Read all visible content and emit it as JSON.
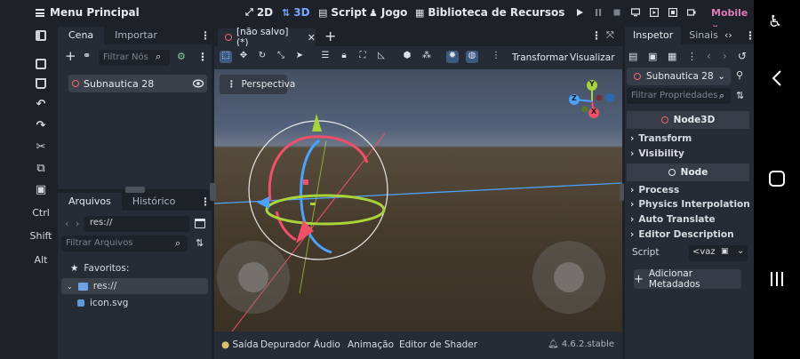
{
  "topbar": {
    "menu_label": "Menu Principal",
    "modes": [
      {
        "label": "2D",
        "icon": "2d-icon"
      },
      {
        "label": "3D",
        "icon": "3d-icon"
      },
      {
        "label": "Script",
        "icon": "script-icon"
      },
      {
        "label": "Jogo",
        "icon": "game-icon"
      },
      {
        "label": "Biblioteca de Recursos",
        "icon": "asset-library-icon"
      }
    ],
    "active_mode": "3D",
    "mobile_label": "Mobile"
  },
  "lefttools": {
    "ctrl_label": "Ctrl",
    "shift_label": "Shift",
    "alt_label": "Alt"
  },
  "scene_dock": {
    "tabs": [
      "Cena",
      "Importar"
    ],
    "filter_placeholder": "Filtrar Nós",
    "root_node": "Subnautica 28"
  },
  "fs_dock": {
    "tabs": [
      "Arquivos",
      "Histórico"
    ],
    "path": "res://",
    "filter_placeholder": "Filtrar Arquivos",
    "favorites_label": "Favoritos:",
    "root_label": "res://",
    "file_label": "icon.svg"
  },
  "viewport": {
    "tab_label": "[não salvo](*)",
    "add_tab": "+",
    "transform_label": "Transformar",
    "view_label": "Visualizar",
    "perspective_label": "Perspectiva",
    "gizmo_labels": {
      "y": "Y",
      "z": "Z",
      "x": "X"
    }
  },
  "bottom": {
    "items": [
      "Saída",
      "Depurador",
      "Áudio",
      "Animação",
      "Editor de Shader"
    ],
    "version": "4.6.2.stable"
  },
  "inspector": {
    "tabs": [
      "Inspetor",
      "Sinais"
    ],
    "node_name": "Subnautica 28",
    "filter_placeholder": "Filtrar Propriedades",
    "section_node3d": "Node3D",
    "transform": "Transform",
    "visibility": "Visibility",
    "section_node": "Node",
    "process": "Process",
    "physics_interp": "Physics Interpolation",
    "auto_translate": "Auto Translate",
    "editor_desc": "Editor Description",
    "script_label": "Script",
    "script_value": "<vaz",
    "add_meta": "Adicionar Metadados"
  },
  "colors": {
    "accent_blue": "#77a7ff",
    "node_red": "#f0656d",
    "mobile_pink": "#e07ab8"
  }
}
